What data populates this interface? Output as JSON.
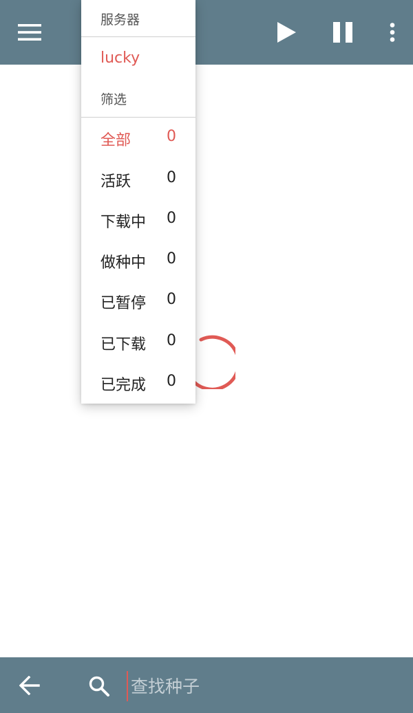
{
  "toolbar": {
    "icons": [
      "menu-icon",
      "play-icon",
      "pause-icon",
      "more-vert-icon"
    ],
    "color": "#607d8b"
  },
  "panel": {
    "server_header": "服务器",
    "server_name": "lucky",
    "filter_header": "筛选",
    "filters": [
      {
        "label": "全部",
        "count": "0",
        "active": true
      },
      {
        "label": "活跃",
        "count": "0",
        "active": false
      },
      {
        "label": "下载中",
        "count": "0",
        "active": false
      },
      {
        "label": "做种中",
        "count": "0",
        "active": false
      },
      {
        "label": "已暂停",
        "count": "0",
        "active": false
      },
      {
        "label": "已下载",
        "count": "0",
        "active": false
      },
      {
        "label": "已完成",
        "count": "0",
        "active": false
      }
    ],
    "accent_color": "#e05a55"
  },
  "search": {
    "placeholder": "查找种子",
    "value": ""
  }
}
